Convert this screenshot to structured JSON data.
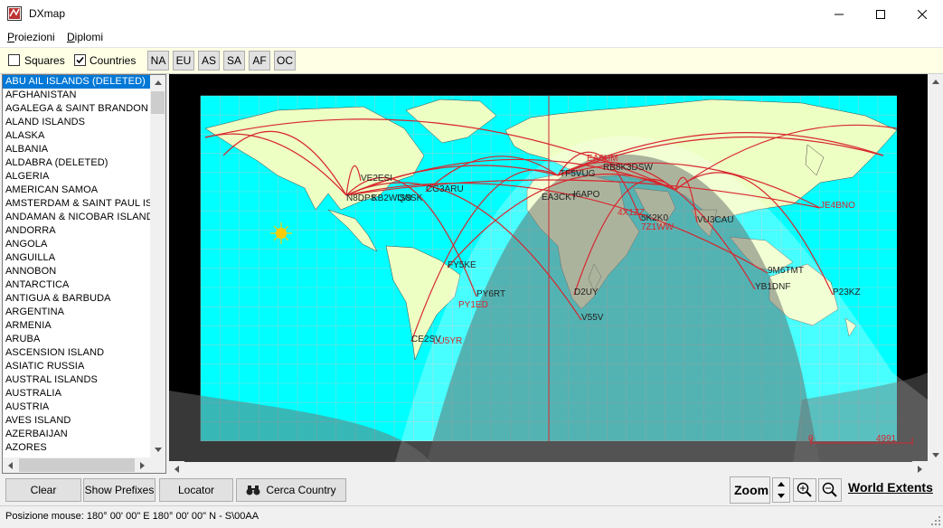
{
  "window": {
    "title": "DXmap"
  },
  "menu": [
    {
      "label": "Proiezioni",
      "underline": "P",
      "rest": "roiezioni"
    },
    {
      "label": "Diplomi",
      "underline": "D",
      "rest": "iplomi"
    }
  ],
  "toolbar": {
    "squares_label": "Squares",
    "squares_checked": false,
    "countries_label": "Countries",
    "countries_checked": true,
    "continents": [
      "NA",
      "EU",
      "AS",
      "SA",
      "AF",
      "OC"
    ]
  },
  "country_list": {
    "selected": "ABU AIL ISLANDS (DELETED)",
    "items": [
      "ABU AIL ISLANDS (DELETED)",
      "AFGHANISTAN",
      "AGALEGA & SAINT BRANDON IS",
      "ALAND ISLANDS",
      "ALASKA",
      "ALBANIA",
      "ALDABRA (DELETED)",
      "ALGERIA",
      "AMERICAN SAMOA",
      "AMSTERDAM & SAINT PAUL ISL",
      "ANDAMAN & NICOBAR ISLANDS",
      "ANDORRA",
      "ANGOLA",
      "ANGUILLA",
      "ANNOBON",
      "ANTARCTICA",
      "ANTIGUA & BARBUDA",
      "ARGENTINA",
      "ARMENIA",
      "ARUBA",
      "ASCENSION ISLAND",
      "ASIATIC RUSSIA",
      "AUSTRAL ISLANDS",
      "AUSTRALIA",
      "AUSTRIA",
      "AVES ISLAND",
      "AZERBAIJAN",
      "AZORES"
    ]
  },
  "map": {
    "spot_labels_dark": [
      "VE2ESI",
      "N8DPS",
      "KB2WQ/9",
      "IS8SK",
      "CG3ARU",
      "FY5KE",
      "PY6RT",
      "CE2SV",
      "D2UY",
      "V55V",
      "5K2K0",
      "VU3CAU",
      "9M6TMT",
      "YB1DNF",
      "P23KZ",
      "EA3CKT",
      "I6APO",
      "TF5VUG",
      "3DSW",
      "RB8K"
    ],
    "spot_labels_red": [
      "PY1ED",
      "LU5YR",
      "JE4BNO",
      "7Z1WW",
      "4X1ZZ",
      "EA6HM"
    ],
    "scale_min": "0",
    "scale_max": "4991"
  },
  "buttons": {
    "clear": "Clear",
    "show_prefixes": "Show Prefixes",
    "locator": "Locator",
    "cerca_country": "Cerca Country",
    "zoom": "Zoom",
    "world_extents": "World Extents"
  },
  "status": {
    "text": "Posizione mouse: 180° 00' 00\" E 180° 00' 00\" N - S\\00AA"
  },
  "colors": {
    "ocean": "#00ffff",
    "land": "#eeffc4",
    "night": "#808080",
    "spots": "#d7262e",
    "selection": "#0078d7"
  }
}
